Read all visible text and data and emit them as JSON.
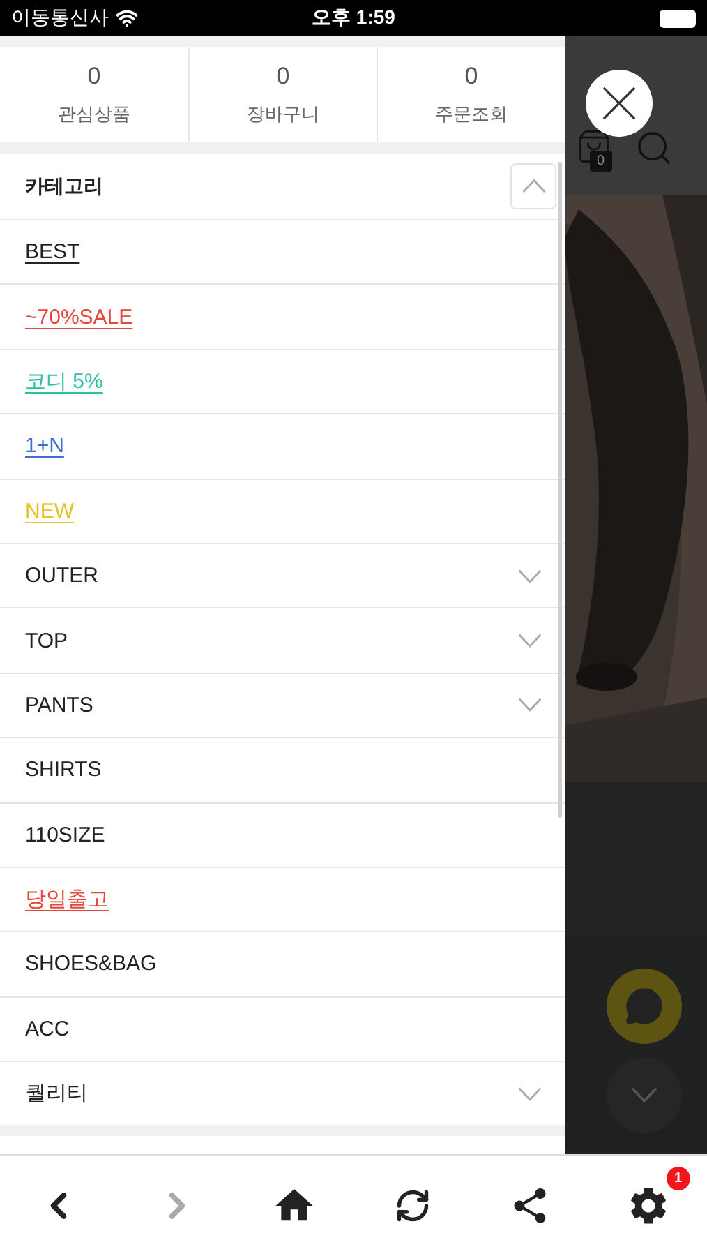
{
  "status_bar": {
    "carrier": "이동통신사",
    "time": "오후 1:59"
  },
  "counters": [
    {
      "value": "0",
      "label": "관심상품"
    },
    {
      "value": "0",
      "label": "장바구니"
    },
    {
      "value": "0",
      "label": "주문조회"
    }
  ],
  "category": {
    "title": "카테고리",
    "expanded": true,
    "items": [
      {
        "label": "BEST",
        "kind": "link",
        "color": "#222222"
      },
      {
        "label": "~70%SALE",
        "kind": "link",
        "color": "#e8453c"
      },
      {
        "label": "코디 5%",
        "kind": "link",
        "color": "#2bbfa4"
      },
      {
        "label": "1+N",
        "kind": "link",
        "color": "#3f6fd1"
      },
      {
        "label": "NEW",
        "kind": "link",
        "color": "#e6c229"
      },
      {
        "label": "OUTER",
        "kind": "menu",
        "expanded": false
      },
      {
        "label": "TOP",
        "kind": "menu",
        "expanded": false
      },
      {
        "label": "PANTS",
        "kind": "menu",
        "expanded": false
      },
      {
        "label": "SHIRTS",
        "kind": "plain"
      },
      {
        "label": "110SIZE",
        "kind": "plain"
      },
      {
        "label": "당일출고",
        "kind": "link",
        "color": "#e8453c"
      },
      {
        "label": "SHOES&BAG",
        "kind": "plain"
      },
      {
        "label": "ACC",
        "kind": "plain"
      },
      {
        "label": "퀄리티",
        "kind": "menu",
        "expanded": false
      }
    ]
  },
  "overlay": {
    "cart_count": "0"
  },
  "bottom_nav": [
    {
      "kind": "back",
      "disabled": false
    },
    {
      "kind": "forward",
      "disabled": true
    },
    {
      "kind": "home",
      "disabled": false
    },
    {
      "kind": "refresh",
      "disabled": false
    },
    {
      "kind": "share",
      "disabled": false
    },
    {
      "kind": "settings",
      "disabled": false,
      "badge": "1"
    }
  ]
}
